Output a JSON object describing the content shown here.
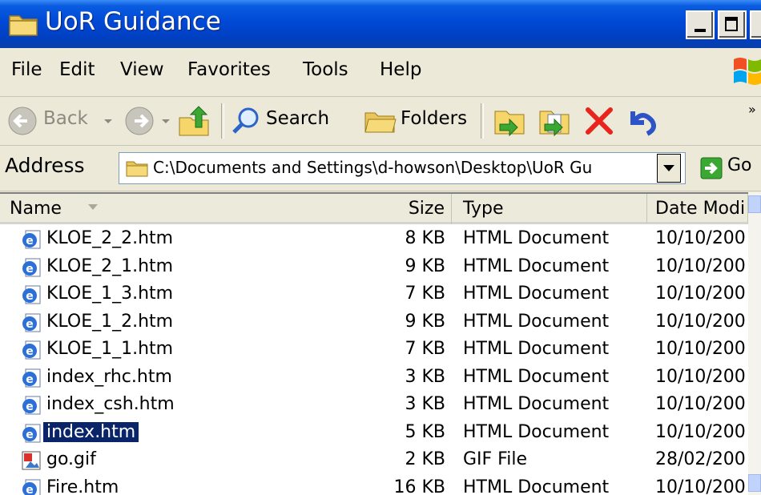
{
  "window": {
    "title": "UoR Guidance"
  },
  "menu": [
    "File",
    "Edit",
    "View",
    "Favorites",
    "Tools",
    "Help"
  ],
  "toolbar": {
    "back_label": "Back",
    "search_label": "Search",
    "folders_label": "Folders"
  },
  "address": {
    "label": "Address",
    "path": "C:\\Documents and Settings\\d-howson\\Desktop\\UoR Gu",
    "go_label": "Go"
  },
  "columns": {
    "name": "Name",
    "size": "Size",
    "type": "Type",
    "date": "Date Modi"
  },
  "files": [
    {
      "name": "KLOE_2_2.htm",
      "size": "8 KB",
      "type": "HTML Document",
      "date": "10/10/200",
      "icon": "html-file-icon"
    },
    {
      "name": "KLOE_2_1.htm",
      "size": "9 KB",
      "type": "HTML Document",
      "date": "10/10/200",
      "icon": "html-file-icon"
    },
    {
      "name": "KLOE_1_3.htm",
      "size": "7 KB",
      "type": "HTML Document",
      "date": "10/10/200",
      "icon": "html-file-icon"
    },
    {
      "name": "KLOE_1_2.htm",
      "size": "9 KB",
      "type": "HTML Document",
      "date": "10/10/200",
      "icon": "html-file-icon"
    },
    {
      "name": "KLOE_1_1.htm",
      "size": "7 KB",
      "type": "HTML Document",
      "date": "10/10/200",
      "icon": "html-file-icon"
    },
    {
      "name": "index_rhc.htm",
      "size": "3 KB",
      "type": "HTML Document",
      "date": "10/10/200",
      "icon": "html-file-icon"
    },
    {
      "name": "index_csh.htm",
      "size": "3 KB",
      "type": "HTML Document",
      "date": "10/10/200",
      "icon": "html-file-icon"
    },
    {
      "name": "index.htm",
      "size": "5 KB",
      "type": "HTML Document",
      "date": "10/10/200",
      "icon": "html-file-icon",
      "selected": true
    },
    {
      "name": "go.gif",
      "size": "2 KB",
      "type": "GIF File",
      "date": "28/02/200",
      "icon": "gif-file-icon"
    },
    {
      "name": "Fire.htm",
      "size": "16 KB",
      "type": "HTML Document",
      "date": "10/10/200",
      "icon": "html-file-icon"
    }
  ],
  "colors": {
    "titlebar": "#0049d6",
    "selection": "#0a246a",
    "delete": "#e8241c"
  }
}
